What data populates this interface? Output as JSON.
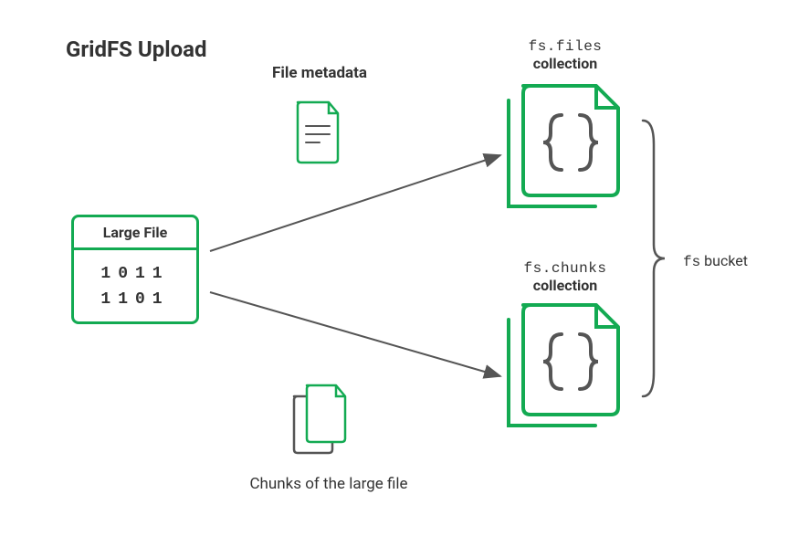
{
  "title": "GridFS Upload",
  "source": {
    "label": "Large File",
    "bits_row_1": "1011",
    "bits_row_2": "1101"
  },
  "metadata": {
    "label": "File metadata"
  },
  "chunks": {
    "label": "Chunks of the large file"
  },
  "collections": {
    "files": {
      "name": "fs.files",
      "sub": "collection"
    },
    "chunks": {
      "name": "fs.chunks",
      "sub": "collection"
    }
  },
  "bucket": {
    "prefix": "fs",
    "word": "bucket"
  },
  "colors": {
    "green": "#13aa52",
    "arrow": "#555555",
    "text": "#333333"
  }
}
